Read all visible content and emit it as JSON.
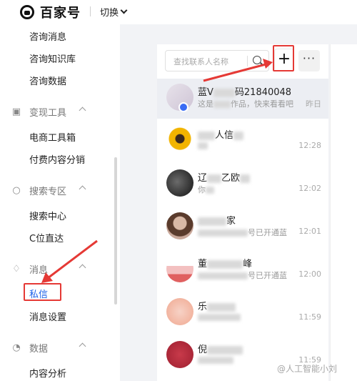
{
  "header": {
    "brand": "百家号",
    "switch_label": "切换"
  },
  "sidebar": {
    "items": [
      {
        "label": "咨询消息"
      },
      {
        "label": "咨询知识库"
      },
      {
        "label": "咨询数据"
      },
      {
        "label": "变现工具",
        "section": true,
        "icon": "wallet-icon"
      },
      {
        "label": "电商工具箱"
      },
      {
        "label": "付费内容分销"
      },
      {
        "label": "搜索专区",
        "section": true,
        "icon": "search-icon"
      },
      {
        "label": "搜索中心"
      },
      {
        "label": "C位直达"
      },
      {
        "label": "消息",
        "section": true,
        "icon": "bell-icon"
      },
      {
        "label": "私信",
        "active": true
      },
      {
        "label": "消息设置"
      },
      {
        "label": "数据",
        "section": true,
        "icon": "pie-chart-icon"
      },
      {
        "label": "内容分析"
      }
    ]
  },
  "search": {
    "placeholder": "查找联系人名称"
  },
  "toolbar": {
    "add_label": "+",
    "more_label": "···"
  },
  "conversations": [
    {
      "name_prefix": "蓝V",
      "name_suffix": "码21840048",
      "preview_prefix": "这是",
      "preview_suffix": "作品，快来看看吧",
      "time": "昨日"
    },
    {
      "name_prefix": "",
      "name_suffix": "人信",
      "preview_prefix": "",
      "preview_suffix": "",
      "time": "12:28"
    },
    {
      "name_prefix": "辽",
      "name_suffix": "乙欧",
      "preview_prefix": "你",
      "preview_suffix": "",
      "time": "12:02"
    },
    {
      "name_prefix": "",
      "name_suffix": "家",
      "preview_prefix": "",
      "preview_suffix": "号已开通蓝",
      "time": "12:01"
    },
    {
      "name_prefix": "董",
      "name_suffix": "峰",
      "preview_prefix": "",
      "preview_suffix": "号已开通蓝",
      "time": "12:00"
    },
    {
      "name_prefix": "乐",
      "name_suffix": "",
      "preview_prefix": "",
      "preview_suffix": "",
      "time": "11:59"
    },
    {
      "name_prefix": "倪",
      "name_suffix": "",
      "preview_prefix": "",
      "preview_suffix": "",
      "time": "11:59"
    }
  ],
  "watermark": "@人工智能小刘",
  "colors": {
    "accent": "#1e63e9",
    "annotation_red": "#e53935",
    "panel_bg": "#f2f3f6"
  }
}
